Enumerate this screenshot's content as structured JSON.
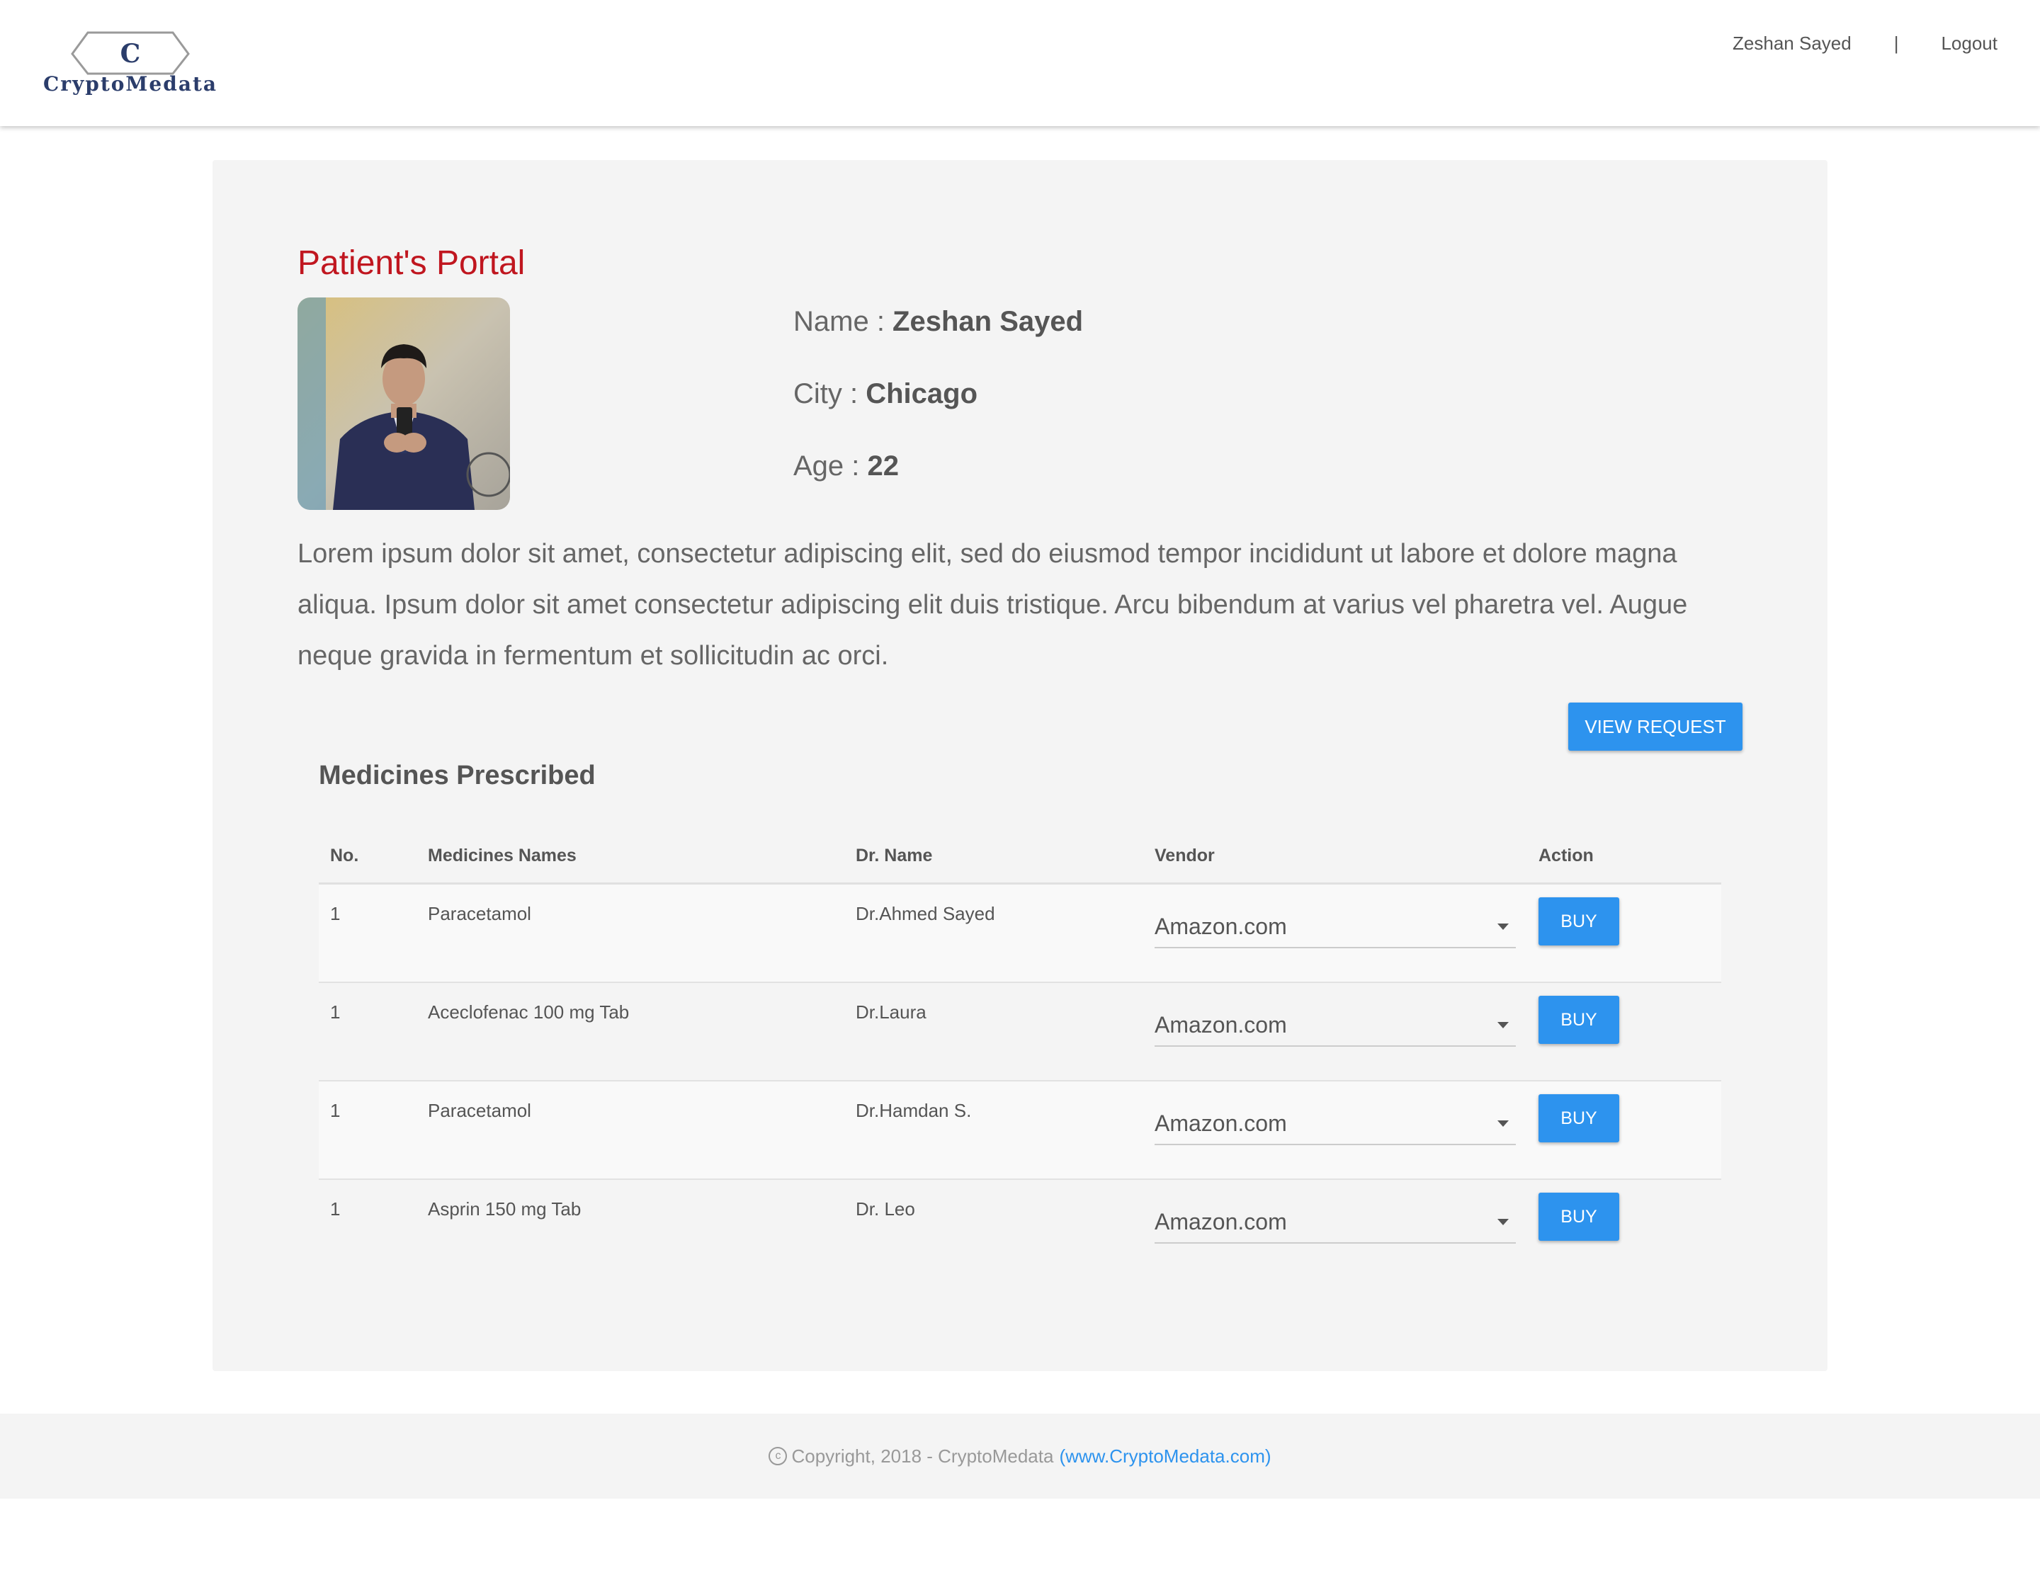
{
  "header": {
    "logo_letter": "C",
    "logo_text": "CryptoMedata",
    "user_name": "Zeshan Sayed",
    "separator": "|",
    "logout_label": "Logout"
  },
  "profile": {
    "portal_title": "Patient's Portal",
    "name_label": "Name : ",
    "name_value": "Zeshan Sayed",
    "city_label": "City : ",
    "city_value": "Chicago",
    "age_label": "Age : ",
    "age_value": "22",
    "bio": "Lorem ipsum dolor sit amet, consectetur adipiscing elit, sed do eiusmod tempor incididunt ut labore et dolore magna aliqua. Ipsum dolor sit amet consectetur adipiscing elit duis tristique. Arcu bibendum at varius vel pharetra vel. Augue neque gravida in fermentum et sollicitudin ac orci."
  },
  "view_request_label": "VIEW REQUEST",
  "medicines": {
    "title": "Medicines Prescribed",
    "columns": [
      "No.",
      "Medicines Names",
      "Dr. Name",
      "Vendor",
      "Action"
    ],
    "rows": [
      {
        "no": "1",
        "name": "Paracetamol",
        "doctor": "Dr.Ahmed Sayed",
        "vendor": "Amazon.com",
        "action": "BUY"
      },
      {
        "no": "1",
        "name": "Aceclofenac 100 mg Tab",
        "doctor": "Dr.Laura",
        "vendor": "Amazon.com",
        "action": "BUY"
      },
      {
        "no": "1",
        "name": "Paracetamol",
        "doctor": "Dr.Hamdan S.",
        "vendor": "Amazon.com",
        "action": "BUY"
      },
      {
        "no": "1",
        "name": "Asprin 150 mg Tab",
        "doctor": "Dr. Leo",
        "vendor": "Amazon.com",
        "action": "BUY"
      }
    ]
  },
  "footer": {
    "copyright_symbol": "c",
    "copyright_text": "Copyright, 2018 - CryptoMedata",
    "link_text": "(www.CryptoMedata.com)"
  },
  "colors": {
    "accent": "#2d93ee",
    "title_red": "#c0161f",
    "logo_blue": "#2b3d6b"
  }
}
